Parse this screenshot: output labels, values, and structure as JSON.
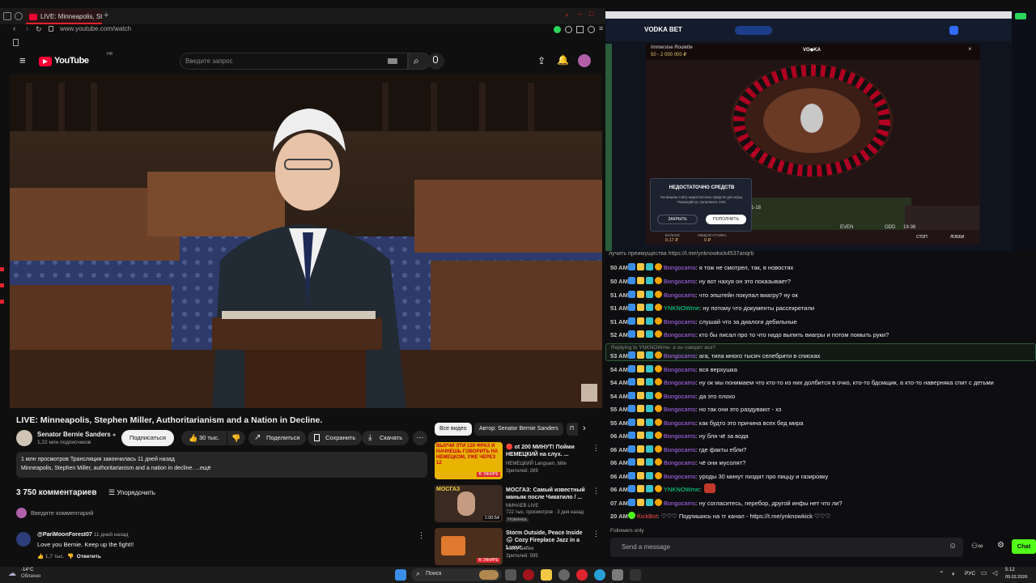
{
  "browser": {
    "tab_title": "LIVE: Minneapolis, Ste",
    "url": "www.youtube.com/watch"
  },
  "youtube": {
    "logo": "YouTube",
    "logo_sup": "HR",
    "search_placeholder": "Введите запрос",
    "video_title": "LIVE: Minneapolis, Stephen Miller, Authoritarianism and a Nation in Decline.",
    "channel_name": "Senator Bernie Sanders",
    "subscribers": "1,22 млн подписчиков",
    "subscribe_label": "Подписаться",
    "likes": "30 тыс.",
    "share_label": "Поделиться",
    "save_label": "Сохранить",
    "download_label": "Скачать",
    "desc_line1": "1 млн просмотров  Трансляция закончилась 11 дней назад",
    "desc_line2": "Minneapolis, Stephen Miller, authoritarianism and a nation in decline. ...ещё",
    "comments_count": "3 750 комментариев",
    "sort_label": "Упорядочить",
    "comment_placeholder": "Введите комментарий",
    "comment": {
      "author": "@PariMoonForest07",
      "time": "11 дней назад",
      "text": "Love you Bernie. Keep up the fight!!",
      "likes": "1,7 тыс.",
      "reply": "Ответить"
    },
    "filter_chips": [
      "Все видео",
      "Автор: Senator Bernie Sanders",
      "П"
    ],
    "recommendations": [
      {
        "title": "🔴 ot 200 МИНУТ! Пойми НЕМЕЦКИЙ на слух. ...",
        "channel": "НЕМЕЦКИЙ Langsam, bitte",
        "meta": "Зрителей: 289",
        "thumb_text": "ВЫУЧИ ЭТИ 120 ФРАЗ И НАЧНЕШЬ ГОВОРИТЬ НА НЕМЕЦКОМ, УЖЕ ЧЕРЕЗ 12",
        "badge": "В ЭФИРЕ"
      },
      {
        "title": "МОСГАЗ: Самый известный маньяк после Чикатило / ...",
        "channel": "МИНАЕВ LIVE",
        "meta": "722 тыс. просмотров · 3 дня назад",
        "tag": "Новинка",
        "duration": "1:00:54",
        "thumb_text": "МОСГАЗ"
      },
      {
        "title": "Storm Outside, Peace Inside 🌧 Cozy Fireplace Jazz in a Luxur...",
        "channel": "Jazzy Coffee",
        "meta": "Зрителей: 595",
        "badge": "В ЭФИРЕ"
      }
    ]
  },
  "casino": {
    "brand": "VODKA BET",
    "game_title": "Immersive Roulette",
    "game_range": "50 - 2 000 000 ₽",
    "dialog_title": "НЕДОСТАТОЧНО СРЕДСТВ",
    "dialog_text": "На вашем счету недостаточно средств для игры. Пожалуйста, пополните счёт.",
    "dialog_close": "ЗАКРЫТЬ",
    "dialog_deposit": "ПОПОЛНИТЬ",
    "balance_label": "БАЛАНС",
    "bet_label": "ОБЩАЯ СТАВКА",
    "balance": "0,17 ₽",
    "bet": "0 ₽",
    "btn_stop": "СТОП",
    "btn_lobby": "ЛОББИ",
    "even_label": "EVEN",
    "odd_label": "ODD",
    "range_label": "19-36",
    "col_label": "1-18"
  },
  "chat": {
    "top_line": "лучить преимущества https://t.me/ynknowkick4537anqrb",
    "reply_hint": "Replying to YNKNOWme: а он говорит вся?",
    "messages": [
      {
        "ts": "50 AM",
        "nick": "Bongocams",
        "type": "b",
        "text": ": я тож не смотрел, так, в новостях"
      },
      {
        "ts": "50 AM",
        "nick": "Bongocams",
        "type": "b",
        "text": ": ну вот нахуя он это показывает?"
      },
      {
        "ts": "51 AM",
        "nick": "Bongocams",
        "type": "b",
        "text": ": что эпштейн покупал виагру? ну ок"
      },
      {
        "ts": "51 AM",
        "nick": "YNKNOWme",
        "type": "y",
        "text": ": ну потому что документы рассекретили"
      },
      {
        "ts": "51 AM",
        "nick": "Bongocams",
        "type": "b",
        "text": ": слушай что за диалоги дебильные"
      },
      {
        "ts": "52 AM",
        "nick": "Bongocams",
        "type": "b",
        "text": ": кто бы писал про то что надо выпить виагры и потом помыть руки?"
      },
      {
        "ts": "53 AM",
        "nick": "Bongocams",
        "type": "b",
        "text": ": ага, типа много тысяч селебрити в списках"
      },
      {
        "ts": "54 AM",
        "nick": "Bongocams",
        "type": "b",
        "text": ": вся верхушка"
      },
      {
        "ts": "54 AM",
        "nick": "Bongocams",
        "type": "b",
        "text": ": ну ок мы понимаем что кто-то из них долбится в очко, кто-то бдсмщик, а кто-то наверняка спит с детьми"
      },
      {
        "ts": "54 AM",
        "nick": "Bongocams",
        "type": "b",
        "text": ": да это плохо"
      },
      {
        "ts": "55 AM",
        "nick": "Bongocams",
        "type": "b",
        "text": ": но так они это раздувают - хз"
      },
      {
        "ts": "55 AM",
        "nick": "Bongocams",
        "type": "b",
        "text": ": как будто это причина всех бед мира"
      },
      {
        "ts": "06 AM",
        "nick": "Bongocams",
        "type": "b",
        "text": ": ну бля чё за вода"
      },
      {
        "ts": "06 AM",
        "nick": "Bongocams",
        "type": "b",
        "text": ": где факты ебли?"
      },
      {
        "ts": "06 AM",
        "nick": "Bongocams",
        "type": "b",
        "text": ": чё они мусолят?"
      },
      {
        "ts": "06 AM",
        "nick": "Bongocams",
        "type": "b",
        "text": ": уроды 30 минут пиздят про пиццу и газировку"
      },
      {
        "ts": "06 AM",
        "nick": "YNKNOWme",
        "type": "y",
        "text": ":"
      },
      {
        "ts": "07 AM",
        "nick": "Bongocams",
        "type": "b",
        "text": ": ну согласитесь, перебор, другой инфы нет что ли?"
      },
      {
        "ts": "20 AM",
        "nick": "KickBot",
        "type": "k",
        "text": ": ♡♡♡ Подпишись на тг канал - https://t.me/ynknowkick ♡♡♡"
      }
    ],
    "followers_only": "Followers only",
    "input_placeholder": "Send a message",
    "chat_button": "Chat"
  },
  "taskbar": {
    "weather_temp": "-14°C",
    "weather_desc": "Облачно",
    "search_label": "Поиск",
    "lang": "РУС",
    "time": "5:12",
    "date": "09.02.2026"
  }
}
